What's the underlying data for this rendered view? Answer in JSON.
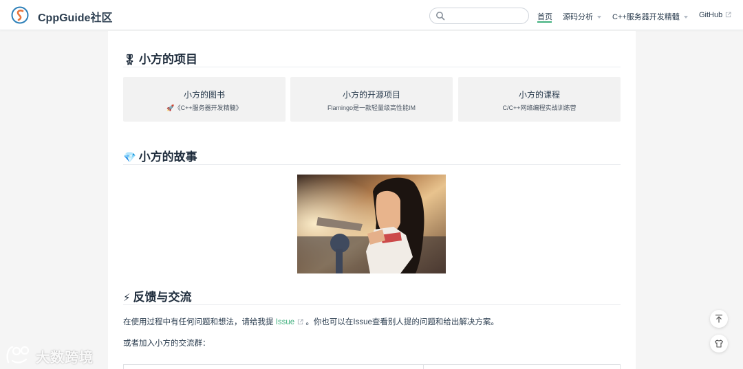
{
  "navbar": {
    "site_name": "CppGuide社区",
    "search": {
      "value": "",
      "placeholder": ""
    },
    "items": [
      {
        "label": "首页"
      },
      {
        "label": "源码分析"
      },
      {
        "label": "C++服务器开发精髓"
      },
      {
        "label": "GitHub"
      }
    ]
  },
  "sections": {
    "projects": {
      "emoji": "🎖",
      "title": "小方的项目",
      "cards": [
        {
          "title": "小方的图书",
          "subtitle": "🚀《C++服务器开发精髓》"
        },
        {
          "title": "小方的开源项目",
          "subtitle": "Flamingo是一款轻量级高性能IM"
        },
        {
          "title": "小方的课程",
          "subtitle": "C/C++网络编程实战训练营"
        }
      ]
    },
    "story": {
      "emoji": "💎",
      "title": "小方的故事"
    },
    "feedback": {
      "emoji": "⚡",
      "title": "反馈与交流",
      "line1_before": "在使用过程中有任何问题和想法，请给我提",
      "link": "Issue",
      "line1_after": "。你也可以在Issue查看别人提的问题和给出解决方案。",
      "line2": "或者加入小方的交流群："
    }
  },
  "watermark": {
    "text": "大数跨境"
  },
  "colors": {
    "accent": "#3eaf7c",
    "text": "#2c3e50",
    "card_bg": "#f2f2f2",
    "page_bg": "#f5f5f5"
  },
  "icons": [
    "logo-icon",
    "search-icon",
    "external-link-icon",
    "back-to-top-icon",
    "theme-shirt-icon"
  ]
}
